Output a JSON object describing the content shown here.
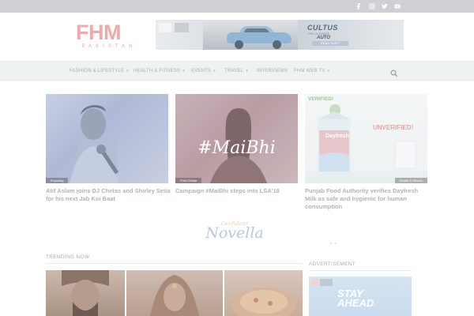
{
  "top_bar": {
    "social_icons": [
      "facebook-icon",
      "instagram-icon",
      "twitter-icon",
      "youtube-icon"
    ]
  },
  "header": {
    "logo_main": "FHM",
    "logo_sub": "PAKISTAN",
    "banner": {
      "headline": "CULTUS",
      "line1": "THE ULTIMATE",
      "line2": "AUTO",
      "line3": "GEAR SHIFT"
    }
  },
  "nav": {
    "items": [
      {
        "label": "FASHION & LIFESTYLE",
        "has_dropdown": true
      },
      {
        "label": "HEALTH & FITNESS",
        "has_dropdown": true
      },
      {
        "label": "EVENTS",
        "has_dropdown": true
      },
      {
        "label": "TRAVEL",
        "has_dropdown": true
      },
      {
        "label": "INTERVIEWS",
        "has_dropdown": false
      },
      {
        "label": "FHM WEB TV",
        "has_dropdown": true
      }
    ],
    "caret": "▾",
    "search_icon": "search-icon"
  },
  "featured": [
    {
      "category": "Exposing",
      "title_lines": [
        "Atif Aslam joins DJ Chetas and Shirley Setia",
        "for his next Jab Koi Baat"
      ]
    },
    {
      "category": "FHM Chime",
      "overlay": "#MaiBhi",
      "title_lines": [
        "Campaign #MaiBhi steps into LSA'18"
      ]
    },
    {
      "category": "Health & Fitness",
      "overlay_top": "VERIFIED!",
      "overlay_side": "UNVERIFIED!",
      "product": "Dayfresh",
      "title_lines": [
        "Punjab Food Authority verifies Dayfresh",
        "Milk as safe and hygienic for human",
        "consumption"
      ]
    }
  ],
  "novella": {
    "small": "Confident",
    "big": "Novella"
  },
  "trending": {
    "heading": "TRENDING NOW"
  },
  "advertisement": {
    "heading": "ADVERTISEMENT",
    "ad_text_line1": "STAY",
    "ad_text_line2": "AHEAD"
  },
  "colors": {
    "top_bar": "#cfcfd4",
    "nav_bg": "#eef2f2",
    "logo": "#f0a9a9",
    "muted_text": "#b0b5b5"
  }
}
